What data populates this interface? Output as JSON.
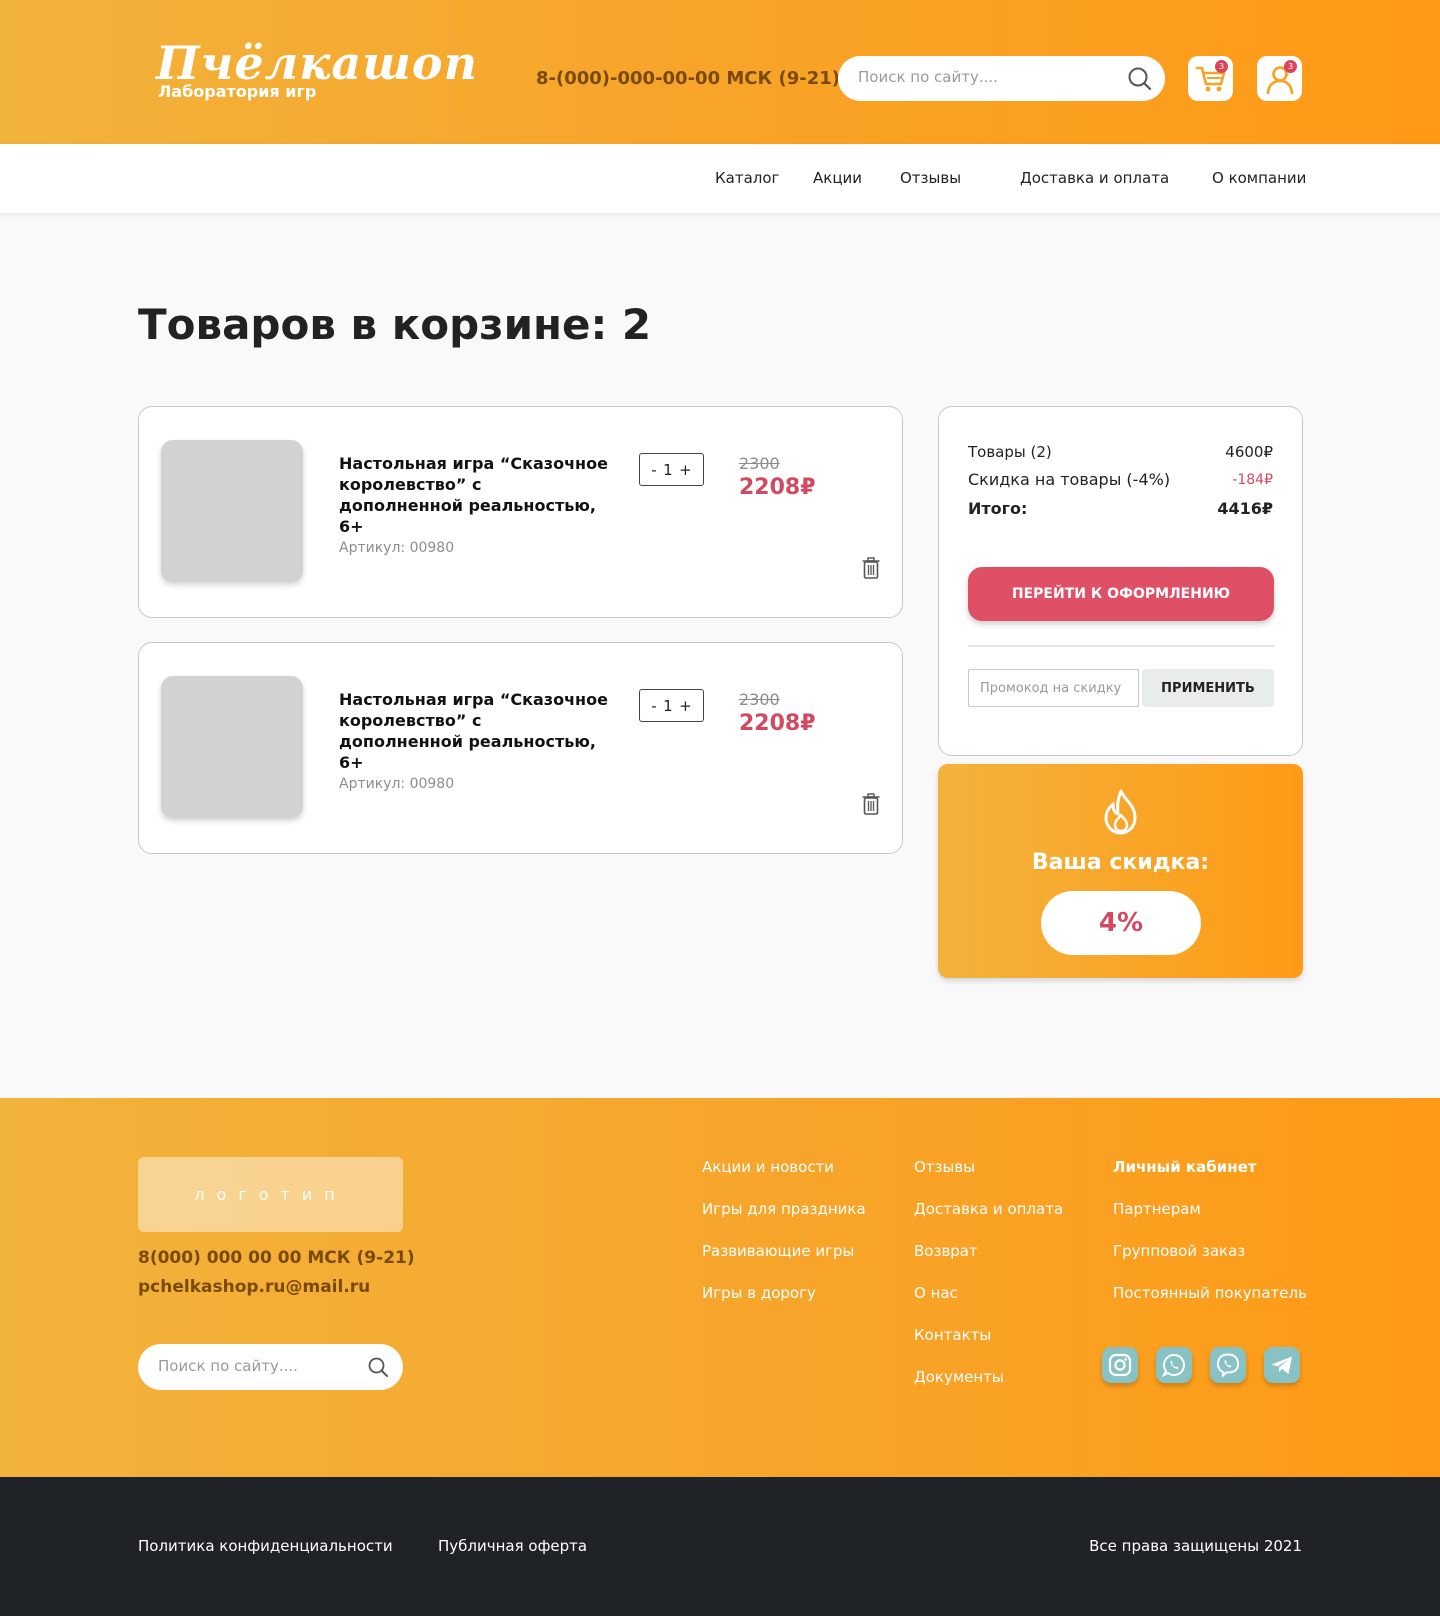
{
  "header": {
    "logo_text": "Пчёлкашоп",
    "logo_sub": "Лаборатория игр",
    "phone": "8-(000)-000-00-00 МСК (9-21)",
    "search_placeholder": "Поиск по сайту....",
    "cart_badge": "3",
    "profile_badge": "3"
  },
  "nav": {
    "items": [
      "Каталог",
      "Акции",
      "Отзывы",
      "Доставка и оплата",
      "О компании"
    ]
  },
  "main": {
    "title": "Товаров в корзине: 2",
    "items": [
      {
        "title": "Настольная игра “Сказочное королевство” с дополненной реальностью, 6+",
        "sku": "Артикул: 00980",
        "qty_minus": "-",
        "qty": "1",
        "qty_plus": "+",
        "old_price": "2300",
        "new_price": "2208₽"
      },
      {
        "title": "Настольная игра “Сказочное королевство” с дополненной реальностью, 6+",
        "sku": "Артикул: 00980",
        "qty_minus": "-",
        "qty": "1",
        "qty_plus": "+",
        "old_price": "2300",
        "new_price": "2208₽"
      }
    ]
  },
  "summary": {
    "goods_label": "Товары (2)",
    "goods_value": "4600₽",
    "discount_label": "Скидка на товары (-4%)",
    "discount_value": "-184₽",
    "total_label": "Итого:",
    "total_value": "4416₽",
    "checkout_label": "ПЕРЕЙТИ К ОФОРМЛЕНИЮ",
    "promo_placeholder": "Промокод на скидку",
    "apply_label": "ПРИМЕНИТЬ"
  },
  "discount_card": {
    "label": "Ваша скидка:",
    "value": "4%"
  },
  "footer": {
    "logo_placeholder": "логотип",
    "phone": "8(000) 000 00 00 МСК (9-21)",
    "email": "pchelkashop.ru@mail.ru",
    "search_placeholder": "Поиск по сайту....",
    "col1": [
      "Акции и новости",
      "Игры для праздника",
      "Развивающие игры",
      "Игры в дорогу"
    ],
    "col2": [
      "Отзывы",
      "Доставка и оплата",
      "Возврат",
      "О нас",
      "Контакты",
      "Документы"
    ],
    "col3": [
      "Личный кабинет",
      "Партнерам",
      "Групповой заказ",
      "Постоянный покупатель"
    ],
    "socials": [
      "instagram-icon",
      "whatsapp-icon",
      "viber-icon",
      "telegram-icon"
    ]
  },
  "bottom": {
    "privacy": "Политика конфиденциальности",
    "offer": "Публичная оферта",
    "copyright": "Все права защищены 2021"
  },
  "colors": {
    "accent_orange": "#ff9a16",
    "accent_red": "#df4f65",
    "dark": "#1f2226",
    "social": "#88c2c4"
  }
}
